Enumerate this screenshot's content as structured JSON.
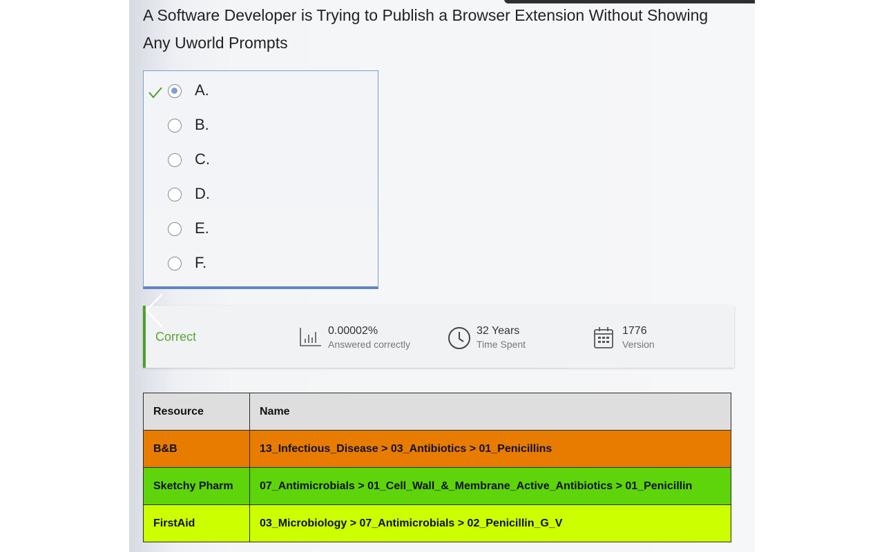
{
  "question": {
    "text": "A Software Developer is Trying to Publish a Browser Extension Without Showing Any Uworld Prompts"
  },
  "answers": {
    "options": [
      {
        "label": "A.",
        "selected": true,
        "correct_mark": true
      },
      {
        "label": "B.",
        "selected": false
      },
      {
        "label": "C.",
        "selected": false
      },
      {
        "label": "D.",
        "selected": false
      },
      {
        "label": "E.",
        "selected": false
      },
      {
        "label": "F.",
        "selected": false
      }
    ]
  },
  "stats": {
    "status": "Correct",
    "answered_value": "0.00002%",
    "answered_label": "Answered correctly",
    "time_value": "32 Years",
    "time_label": "Time Spent",
    "version_value": "1776",
    "version_label": "Version"
  },
  "resources": {
    "headers": [
      "Resource",
      "Name"
    ],
    "rows": [
      {
        "resource": "B&B",
        "name": "13_Infectious_Disease > 03_Antibiotics > 01_Penicillins"
      },
      {
        "resource": "Sketchy Pharm",
        "name": "07_Antimicrobials > 01_Cell_Wall_&_Membrane_Active_Antibiotics > 01_Penicillin"
      },
      {
        "resource": "FirstAid",
        "name": "03_Microbiology > 07_Antimicrobials > 02_Penicillin_G_V"
      }
    ]
  },
  "colors": {
    "correct_green": "#4ca02c",
    "row_bb": "#e87c00",
    "row_sketchy": "#5ed40a",
    "row_firstaid": "#ccff00",
    "selected_radio": "#7d9fd6"
  },
  "icons": [
    "check-icon",
    "bar-chart-icon",
    "clock-icon",
    "calendar-icon",
    "chevron-left-icon"
  ]
}
